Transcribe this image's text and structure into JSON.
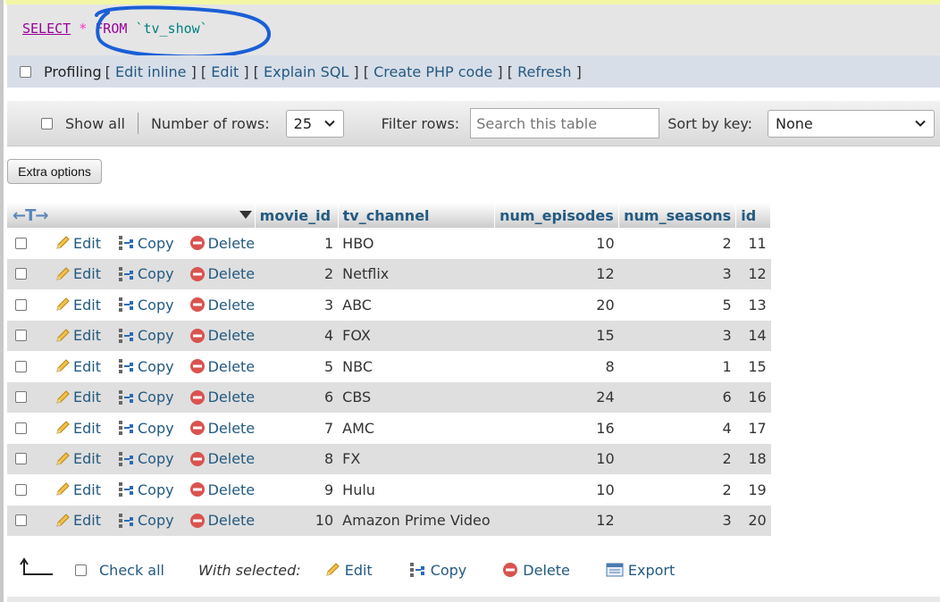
{
  "sql": {
    "select": "SELECT",
    "star": "*",
    "from": "FROM",
    "table": "`tv_show`",
    "annotation_color": "#1a5fd6"
  },
  "profiling": {
    "label": "Profiling",
    "links": [
      "Edit inline",
      "Edit",
      "Explain SQL",
      "Create PHP code",
      "Refresh"
    ]
  },
  "nav": {
    "show_all": "Show all",
    "rows_label": "Number of rows:",
    "rows_value": "25",
    "filter_label": "Filter rows:",
    "filter_placeholder": "Search this table",
    "sort_label": "Sort by key:",
    "sort_value": "None"
  },
  "extra_options": "Extra options",
  "table": {
    "columns": [
      "movie_id",
      "tv_channel",
      "num_episodes",
      "num_seasons",
      "id"
    ],
    "actions": {
      "edit": "Edit",
      "copy": "Copy",
      "delete": "Delete"
    },
    "rows": [
      [
        "1",
        "HBO",
        "10",
        "2",
        "11"
      ],
      [
        "2",
        "Netflix",
        "12",
        "3",
        "12"
      ],
      [
        "3",
        "ABC",
        "20",
        "5",
        "13"
      ],
      [
        "4",
        "FOX",
        "15",
        "3",
        "14"
      ],
      [
        "5",
        "NBC",
        "8",
        "1",
        "15"
      ],
      [
        "6",
        "CBS",
        "24",
        "6",
        "16"
      ],
      [
        "7",
        "AMC",
        "16",
        "4",
        "17"
      ],
      [
        "8",
        "FX",
        "10",
        "2",
        "18"
      ],
      [
        "9",
        "Hulu",
        "10",
        "2",
        "19"
      ],
      [
        "10",
        "Amazon Prime Video",
        "12",
        "3",
        "20"
      ]
    ]
  },
  "bottom": {
    "check_all": "Check all",
    "with_selected": "With selected:",
    "edit": "Edit",
    "copy": "Copy",
    "delete": "Delete",
    "export": "Export"
  },
  "colors": {
    "link": "#235a81",
    "row_alt": "#dfdfdf",
    "delete_red": "#d9534f"
  }
}
